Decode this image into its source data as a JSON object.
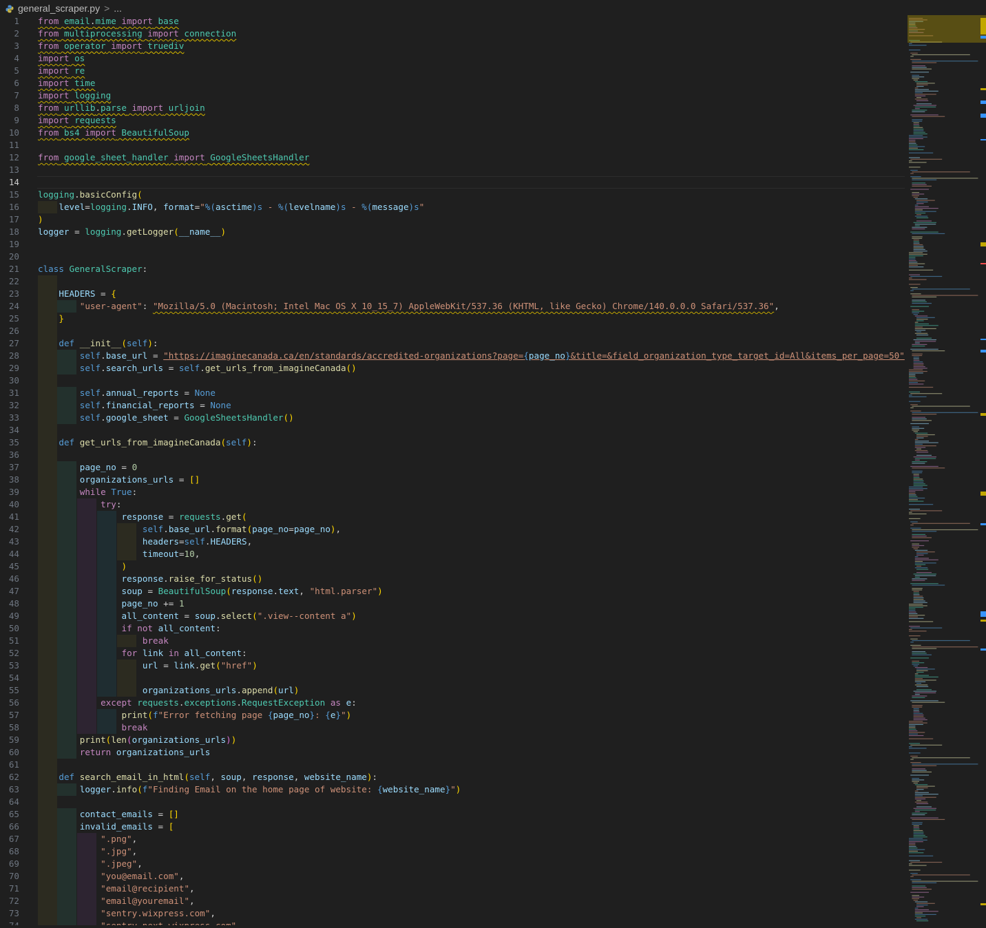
{
  "breadcrumb": {
    "file": "general_scraper.py",
    "separator": ">",
    "trail": "..."
  },
  "editor": {
    "current_line": 14,
    "lines": [
      {
        "n": "1",
        "t": "from email.mime import base"
      },
      {
        "n": "2",
        "t": "from multiprocessing import connection"
      },
      {
        "n": "3",
        "t": "from operator import truediv"
      },
      {
        "n": "4",
        "t": "import os"
      },
      {
        "n": "5",
        "t": "import re"
      },
      {
        "n": "6",
        "t": "import time"
      },
      {
        "n": "7",
        "t": "import logging"
      },
      {
        "n": "8",
        "t": "from urllib.parse import urljoin"
      },
      {
        "n": "9",
        "t": "import requests"
      },
      {
        "n": "10",
        "t": "from bs4 import BeautifulSoup"
      },
      {
        "n": "11",
        "t": ""
      },
      {
        "n": "12",
        "t": "from google_sheet_handler import GoogleSheetsHandler"
      },
      {
        "n": "13",
        "t": ""
      },
      {
        "n": "14",
        "t": ""
      },
      {
        "n": "15",
        "t": "logging.basicConfig("
      },
      {
        "n": "16",
        "t": "    level=logging.INFO, format=\"%(asctime)s - %(levelname)s - %(message)s\""
      },
      {
        "n": "17",
        "t": ")"
      },
      {
        "n": "18",
        "t": "logger = logging.getLogger(__name__)"
      },
      {
        "n": "19",
        "t": ""
      },
      {
        "n": "20",
        "t": ""
      },
      {
        "n": "21",
        "t": "class GeneralScraper:"
      },
      {
        "n": "22",
        "t": ""
      },
      {
        "n": "23",
        "t": "    HEADERS = {"
      },
      {
        "n": "24",
        "t": "        \"user-agent\": \"Mozilla/5.0 (Macintosh; Intel Mac OS X 10_15_7) AppleWebKit/537.36 (KHTML, like Gecko) Chrome/140.0.0.0 Safari/537.36\","
      },
      {
        "n": "25",
        "t": "    }"
      },
      {
        "n": "26",
        "t": ""
      },
      {
        "n": "27",
        "t": "    def __init__(self):"
      },
      {
        "n": "28",
        "t": "        self.base_url = \"https://imaginecanada.ca/en/standards/accredited-organizations?page={page_no}&title=&field_organization_type_target_id=All&items_per_page=50\""
      },
      {
        "n": "29",
        "t": "        self.search_urls = self.get_urls_from_imagineCanada()"
      },
      {
        "n": "30",
        "t": ""
      },
      {
        "n": "31",
        "t": "        self.annual_reports = None"
      },
      {
        "n": "32",
        "t": "        self.financial_reports = None"
      },
      {
        "n": "33",
        "t": "        self.google_sheet = GoogleSheetsHandler()"
      },
      {
        "n": "34",
        "t": ""
      },
      {
        "n": "35",
        "t": "    def get_urls_from_imagineCanada(self):"
      },
      {
        "n": "36",
        "t": ""
      },
      {
        "n": "37",
        "t": "        page_no = 0"
      },
      {
        "n": "38",
        "t": "        organizations_urls = []"
      },
      {
        "n": "39",
        "t": "        while True:"
      },
      {
        "n": "40",
        "t": "            try:"
      },
      {
        "n": "41",
        "t": "                response = requests.get("
      },
      {
        "n": "42",
        "t": "                    self.base_url.format(page_no=page_no),"
      },
      {
        "n": "43",
        "t": "                    headers=self.HEADERS,"
      },
      {
        "n": "44",
        "t": "                    timeout=10,"
      },
      {
        "n": "45",
        "t": "                )"
      },
      {
        "n": "46",
        "t": "                response.raise_for_status()"
      },
      {
        "n": "47",
        "t": "                soup = BeautifulSoup(response.text, \"html.parser\")"
      },
      {
        "n": "48",
        "t": "                page_no += 1"
      },
      {
        "n": "49",
        "t": "                all_content = soup.select(\".view--content a\")"
      },
      {
        "n": "50",
        "t": "                if not all_content:"
      },
      {
        "n": "51",
        "t": "                    break"
      },
      {
        "n": "52",
        "t": "                for link in all_content:"
      },
      {
        "n": "53",
        "t": "                    url = link.get(\"href\")"
      },
      {
        "n": "54",
        "t": ""
      },
      {
        "n": "55",
        "t": "                    organizations_urls.append(url)"
      },
      {
        "n": "56",
        "t": "            except requests.exceptions.RequestException as e:"
      },
      {
        "n": "57",
        "t": "                print(f\"Error fetching page {page_no}: {e}\")"
      },
      {
        "n": "58",
        "t": "                break"
      },
      {
        "n": "59",
        "t": "        print(len(organizations_urls))"
      },
      {
        "n": "60",
        "t": "        return organizations_urls"
      },
      {
        "n": "61",
        "t": ""
      },
      {
        "n": "62",
        "t": "    def search_email_in_html(self, soup, response, website_name):"
      },
      {
        "n": "63",
        "t": "        logger.info(f\"Finding Email on the home page of website: {website_name}\")"
      },
      {
        "n": "64",
        "t": ""
      },
      {
        "n": "65",
        "t": "        contact_emails = []"
      },
      {
        "n": "66",
        "t": "        invalid_emails = ["
      },
      {
        "n": "67",
        "t": "            \".png\","
      },
      {
        "n": "68",
        "t": "            \".jpg\","
      },
      {
        "n": "69",
        "t": "            \".jpeg\","
      },
      {
        "n": "70",
        "t": "            \"you@email.com\","
      },
      {
        "n": "71",
        "t": "            \"email@recipient\","
      },
      {
        "n": "72",
        "t": "            \"email@youremail\","
      },
      {
        "n": "73",
        "t": "            \"sentry.wixpress.com\","
      },
      {
        "n": "74",
        "t": "            \"sentry-next.wixpress.com\","
      }
    ]
  },
  "colors": {
    "background": "#1f1f1f",
    "keyword": "#c586c0",
    "function": "#dcdcaa",
    "class": "#4ec9b0",
    "string": "#ce9178",
    "variable": "#9cdcfe",
    "warning_squiggle": "#c2a700",
    "info_squiggle": "#3794ff"
  }
}
